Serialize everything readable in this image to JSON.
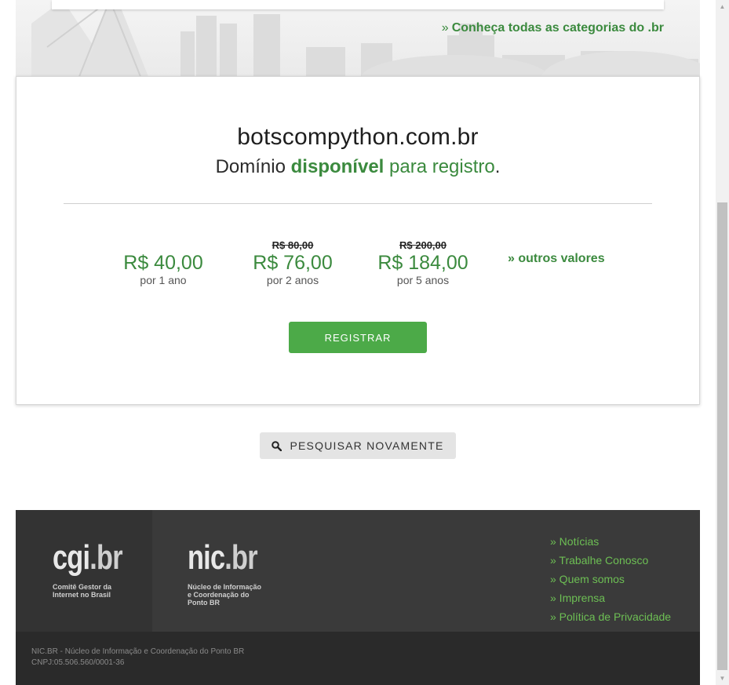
{
  "header": {
    "categories_link_arrow": "»",
    "categories_link": "Conheça todas as categorias do .br"
  },
  "result": {
    "domain": "botscompython.com.br",
    "availability_prefix": "Domínio",
    "availability_status": "disponível",
    "availability_suffix": "para registro",
    "availability_end": "."
  },
  "prices": [
    {
      "old": "",
      "value": "R$ 40,00",
      "period": "por 1 ano"
    },
    {
      "old": "R$ 80,00",
      "value": "R$ 76,00",
      "period": "por 2 anos"
    },
    {
      "old": "R$ 200,00",
      "value": "R$ 184,00",
      "period": "por 5 anos"
    }
  ],
  "other_values": "» outros valores",
  "register_label": "REGISTRAR",
  "search_again_label": "PESQUISAR NOVAMENTE",
  "footer": {
    "cgi_logo": {
      "name": "cgi",
      "dot": ".",
      "tld": "br",
      "subtitle": [
        "Comitê Gestor da",
        "Internet no Brasil"
      ]
    },
    "nic_logo": {
      "name": "nic",
      "dot": ".",
      "tld": "br",
      "subtitle": [
        "Núcleo de Informação",
        "e Coordenação do",
        "Ponto BR"
      ]
    },
    "links": [
      "» Notícias",
      "» Trabalhe Conosco",
      "» Quem somos",
      "» Imprensa",
      "» Política de Privacidade"
    ],
    "org_line": "NIC.BR - Núcleo de Informação e Coordenação do Ponto BR",
    "cnpj_line": "CNPJ:05.506.560/0001-36"
  },
  "colors": {
    "accent_green": "#3b8a3e",
    "button_green": "#4caa48",
    "link_green": "#6dbf54",
    "footer_bg": "#3a3a3a"
  },
  "icons": {
    "search_icon": "magnifier",
    "scroll_up_icon": "triangle-up",
    "scroll_down_icon": "triangle-down"
  }
}
